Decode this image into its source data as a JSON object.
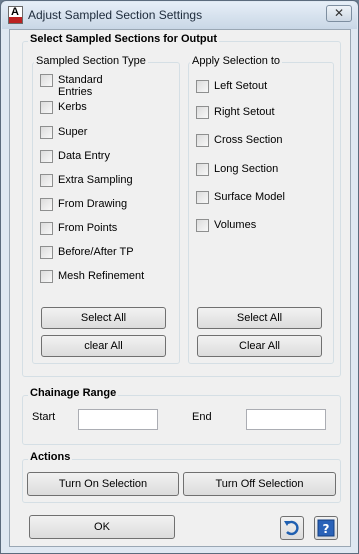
{
  "window": {
    "title": "Adjust Sampled Section Settings",
    "close_symbol": "✕"
  },
  "output_group": {
    "title": "Select Sampled Sections for Output",
    "section_type": {
      "title": "Sampled Section Type",
      "items": [
        "Standard Entries",
        "Kerbs",
        "Super",
        "Data Entry",
        "Extra Sampling",
        "From Drawing",
        "From Points",
        "Before/After TP",
        "Mesh Refinement"
      ],
      "select_all": "Select All",
      "clear_all": "clear All"
    },
    "apply_to": {
      "title": "Apply Selection to",
      "items": [
        "Left Setout",
        "Right Setout",
        "Cross Section",
        "Long Section",
        "Surface Model",
        "Volumes"
      ],
      "select_all": "Select All",
      "clear_all": "Clear All"
    }
  },
  "chainage": {
    "title": "Chainage Range",
    "start_label": "Start",
    "start_value": "",
    "end_label": "End",
    "end_value": ""
  },
  "actions": {
    "title": "Actions",
    "turn_on": "Turn On Selection",
    "turn_off": "Turn Off Selection"
  },
  "footer": {
    "ok": "OK",
    "undo_icon": "undo-icon",
    "help_icon": "help-icon"
  }
}
